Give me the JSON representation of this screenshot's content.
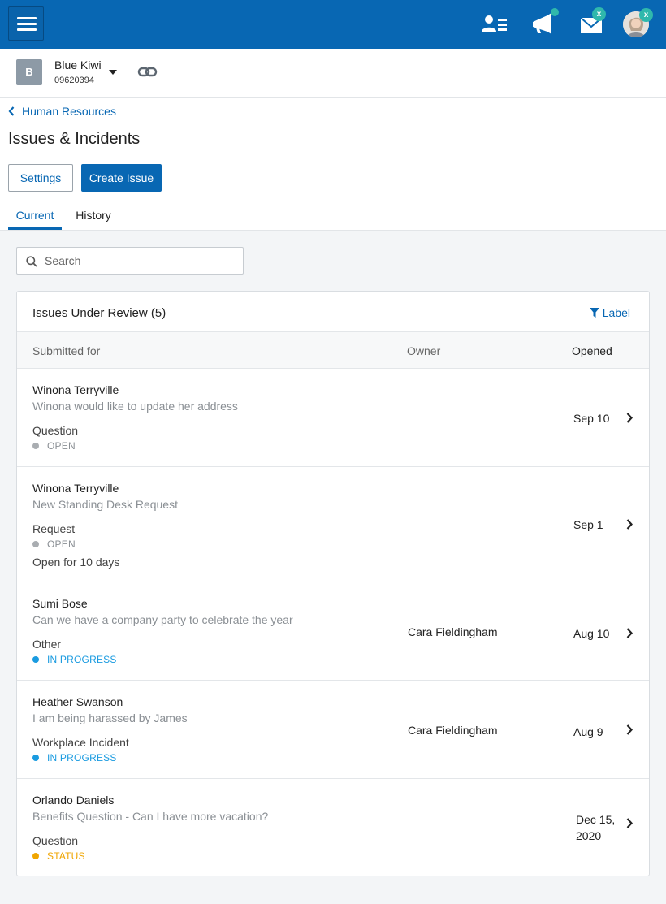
{
  "topbar": {
    "menu_icon": "hamburger-menu-icon",
    "people_icon": "people-list-icon",
    "announce_icon": "megaphone-icon",
    "mail_icon": "mail-icon",
    "mail_badge": "x",
    "avatar_badge": "x",
    "brand_color": "#0867b3"
  },
  "company": {
    "logo_letter": "B",
    "name": "Blue Kiwi",
    "id": "09620394"
  },
  "breadcrumb": {
    "label": "Human Resources"
  },
  "page": {
    "title": "Issues & Incidents"
  },
  "actions": {
    "settings_label": "Settings",
    "create_label": "Create Issue"
  },
  "tabs": [
    {
      "label": "Current",
      "active": true
    },
    {
      "label": "History",
      "active": false
    }
  ],
  "search": {
    "placeholder": "Search",
    "value": ""
  },
  "card": {
    "title": "Issues Under Review (5)",
    "filter_label": "Label",
    "columns": {
      "submitted_for": "Submitted for",
      "owner": "Owner",
      "opened": "Opened"
    },
    "rows": [
      {
        "name": "Winona Terryville",
        "description": "Winona would like to update her address",
        "type": "Question",
        "status": "OPEN",
        "status_color": "#a9adb1",
        "extra": "",
        "owner": "",
        "opened": "Sep 10"
      },
      {
        "name": "Winona Terryville",
        "description": "New Standing Desk Request",
        "type": "Request",
        "status": "OPEN",
        "status_color": "#a9adb1",
        "extra": "Open for 10 days",
        "owner": "",
        "opened": "Sep 1"
      },
      {
        "name": "Sumi Bose",
        "description": "Can we have a company party to celebrate the year",
        "type": "Other",
        "status": "IN PROGRESS",
        "status_color": "#1a9be0",
        "extra": "",
        "owner": "Cara Fieldingham",
        "opened": "Aug 10"
      },
      {
        "name": "Heather Swanson",
        "description": "I am being harassed by James",
        "type": "Workplace Incident",
        "status": "IN PROGRESS",
        "status_color": "#1a9be0",
        "extra": "",
        "owner": "Cara Fieldingham",
        "opened": "Aug 9"
      },
      {
        "name": "Orlando Daniels",
        "description": "Benefits Question - Can I have more vacation?",
        "type": "Question",
        "status": "STATUS",
        "status_color": "#f0a500",
        "extra": "",
        "owner": "",
        "opened": "Dec 15,",
        "opened_line2": "2020"
      }
    ]
  }
}
